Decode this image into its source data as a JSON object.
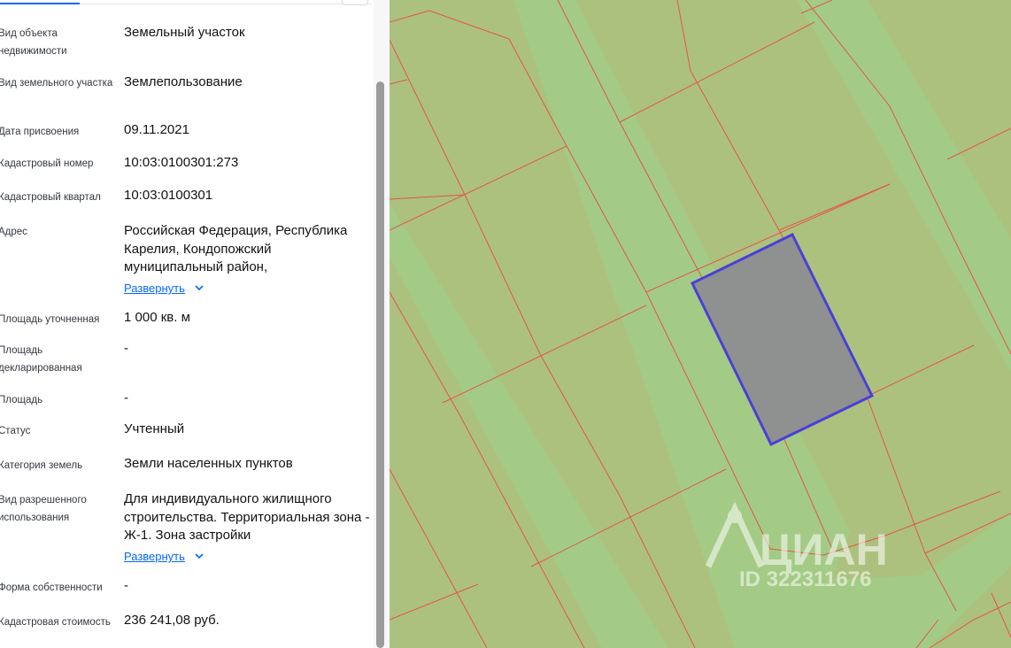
{
  "property_details": {
    "rows": [
      {
        "label": "Вид объекта недвижимости",
        "value": "Земельный участок"
      },
      {
        "label": "Вид земельного участка",
        "value": "Землепользование"
      },
      {
        "label": "Дата присвоения",
        "value": "09.11.2021"
      },
      {
        "label": "Кадастровый номер",
        "value": "10:03:0100301:273"
      },
      {
        "label": "Кадастровый квартал",
        "value": "10:03:0100301"
      },
      {
        "label": "Адрес",
        "value": "Российская Федерация, Республика Карелия, Кондопожский муниципальный район,",
        "expand_label": "Развернуть"
      },
      {
        "label": "Площадь уточненная",
        "value": "1 000 кв. м"
      },
      {
        "label": "Площадь декларированная",
        "value": "-"
      },
      {
        "label": "Площадь",
        "value": "-"
      },
      {
        "label": "Статус",
        "value": "Учтенный"
      },
      {
        "label": "Категория земель",
        "value": "Земли населенных пунктов"
      },
      {
        "label": "Вид разрешенного использования",
        "value": "Для индивидуального жилищного строительства. Территориальная зона - Ж-1. Зона застройки",
        "expand_label": "Развернуть"
      },
      {
        "label": "Форма собственности",
        "value": "-"
      },
      {
        "label": "Кадастровая стоимость",
        "value": "236 241,08 руб."
      }
    ]
  },
  "map": {
    "watermark_brand": "ЦИАН",
    "watermark_id": "ID 322311676",
    "colors": {
      "parcel_fill": "#adc17e",
      "road_fill": "#a4cb85",
      "boundary_line": "#e0564a",
      "selected_fill": "#8e9190",
      "selected_stroke": "#4b3fd9"
    }
  }
}
